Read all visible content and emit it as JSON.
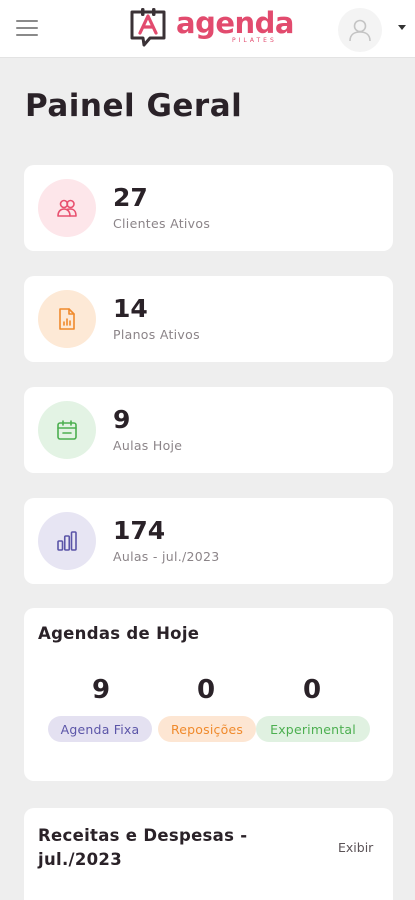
{
  "header": {
    "logo_text": "agenda",
    "logo_subtitle": "PILATES"
  },
  "page": {
    "title": "Painel Geral"
  },
  "stats": [
    {
      "value": "27",
      "label": "Clientes Ativos",
      "icon": "clients-icon",
      "color": "#e8506f",
      "bg": "#fde6ea"
    },
    {
      "value": "14",
      "label": "Planos Ativos",
      "icon": "plans-icon",
      "color": "#f08a2c",
      "bg": "#fde9d6"
    },
    {
      "value": "9",
      "label": "Aulas Hoje",
      "icon": "calendar-icon",
      "color": "#4caf50",
      "bg": "#e3f3e4"
    },
    {
      "value": "174",
      "label": "Aulas - jul./2023",
      "icon": "bar-chart-icon",
      "color": "#5b55a8",
      "bg": "#e7e5f3"
    }
  ],
  "agendas": {
    "title": "Agendas de Hoje",
    "items": [
      {
        "value": "9",
        "label": "Agenda Fixa",
        "color": "#5b55a8",
        "bg": "#e4e1f1"
      },
      {
        "value": "0",
        "label": "Reposições",
        "color": "#f08a2c",
        "bg": "#fde6d3"
      },
      {
        "value": "0",
        "label": "Experimental",
        "color": "#4caf50",
        "bg": "#e0f1e1"
      }
    ]
  },
  "finance": {
    "title": "Receitas e Despesas - jul./2023",
    "action": "Exibir"
  }
}
